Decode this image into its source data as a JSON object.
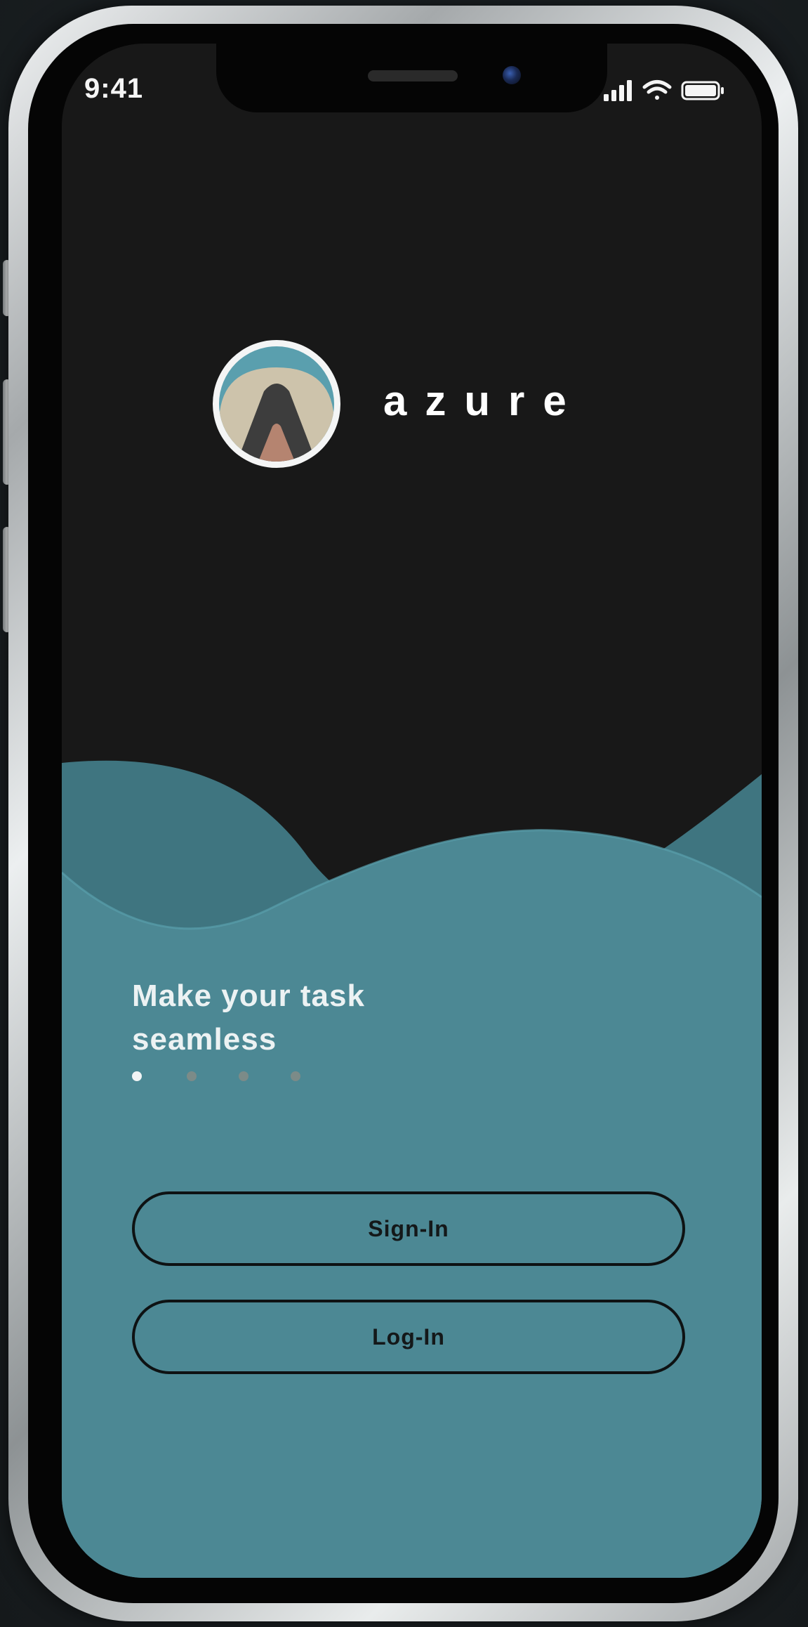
{
  "status_bar": {
    "time": "9:41",
    "signal_icon": "cellular-signal-icon",
    "wifi_icon": "wifi-icon",
    "battery_icon": "battery-icon"
  },
  "brand": {
    "name": "azure",
    "logo_icon": "mountain-logo-icon"
  },
  "onboarding": {
    "tagline_line1": "Make your task",
    "tagline_line2": "seamless",
    "pager": {
      "total_pages": 4,
      "current_page": 1
    }
  },
  "actions": {
    "signin_label": "Sign-In",
    "login_label": "Log-In"
  },
  "colors": {
    "screen_background": "#181818",
    "wave_teal": "#4c8894",
    "wave_back": "#3f7580",
    "logo_ring": "#f4f5f5",
    "logo_sky": "#5a9fae",
    "logo_sand": "#cdc3ab",
    "logo_rock": "#3d3d3d",
    "logo_clay": "#b58470",
    "button_border": "#0e1213"
  }
}
